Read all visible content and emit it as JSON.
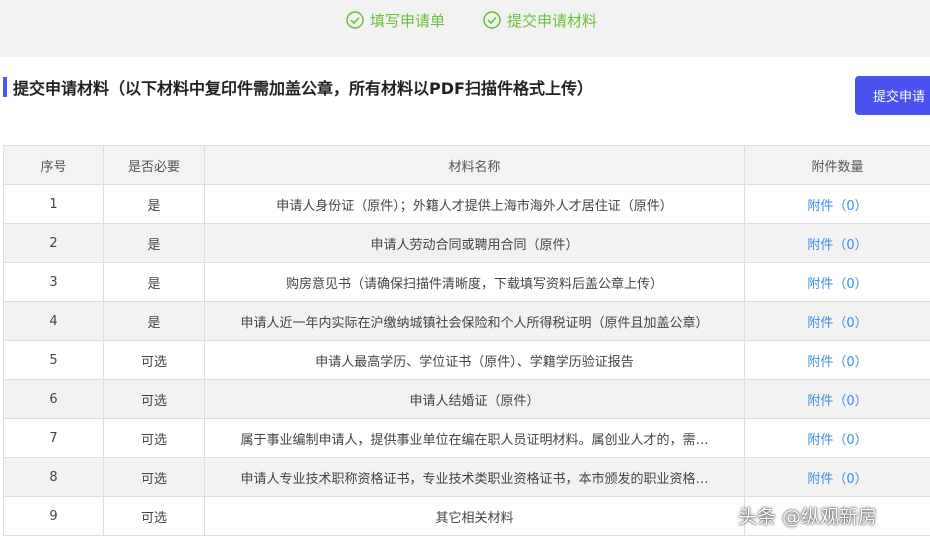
{
  "steps": [
    {
      "label": "填写申请单",
      "icon": "check-circle-icon"
    },
    {
      "label": "提交申请材料",
      "icon": "check-circle-icon"
    }
  ],
  "section": {
    "title": "提交申请材料（以下材料中复印件需加盖公章，所有材料以PDF扫描件格式上传）"
  },
  "submit_button": {
    "label": "提交申请"
  },
  "table": {
    "headers": [
      "序号",
      "是否必要",
      "材料名称",
      "附件数量"
    ],
    "rows": [
      {
        "no": "1",
        "required": "是",
        "name": "申请人身份证（原件）；外籍人才提供上海市海外人才居住证（原件）",
        "attach": "附件（0）"
      },
      {
        "no": "2",
        "required": "是",
        "name": "申请人劳动合同或聘用合同（原件）",
        "attach": "附件（0）"
      },
      {
        "no": "3",
        "required": "是",
        "name": "购房意见书（请确保扫描件清晰度，下载填写资料后盖公章上传）",
        "attach": "附件（0）"
      },
      {
        "no": "4",
        "required": "是",
        "name": "申请人近一年内实际在沪缴纳城镇社会保险和个人所得税证明（原件且加盖公章）",
        "attach": "附件（0）"
      },
      {
        "no": "5",
        "required": "可选",
        "name": "申请人最高学历、学位证书（原件）、学籍学历验证报告",
        "attach": "附件（0）"
      },
      {
        "no": "6",
        "required": "可选",
        "name": "申请人结婚证（原件）",
        "attach": "附件（0）"
      },
      {
        "no": "7",
        "required": "可选",
        "name": "属于事业编制申请人，提供事业单位在编在职人员证明材料。属创业人才的，需…",
        "attach": "附件（0）"
      },
      {
        "no": "8",
        "required": "可选",
        "name": "申请人专业技术职称资格证书，专业技术类职业资格证书，本市颁发的职业资格…",
        "attach": "附件（0）"
      },
      {
        "no": "9",
        "required": "可选",
        "name": "其它相关材料",
        "attach": ""
      }
    ]
  },
  "watermark": {
    "text": "头条 @纵观新房"
  },
  "colors": {
    "accent": "#4a52f0",
    "success": "#67c23a",
    "required": "#e0484b",
    "link": "#3e8ee8"
  }
}
